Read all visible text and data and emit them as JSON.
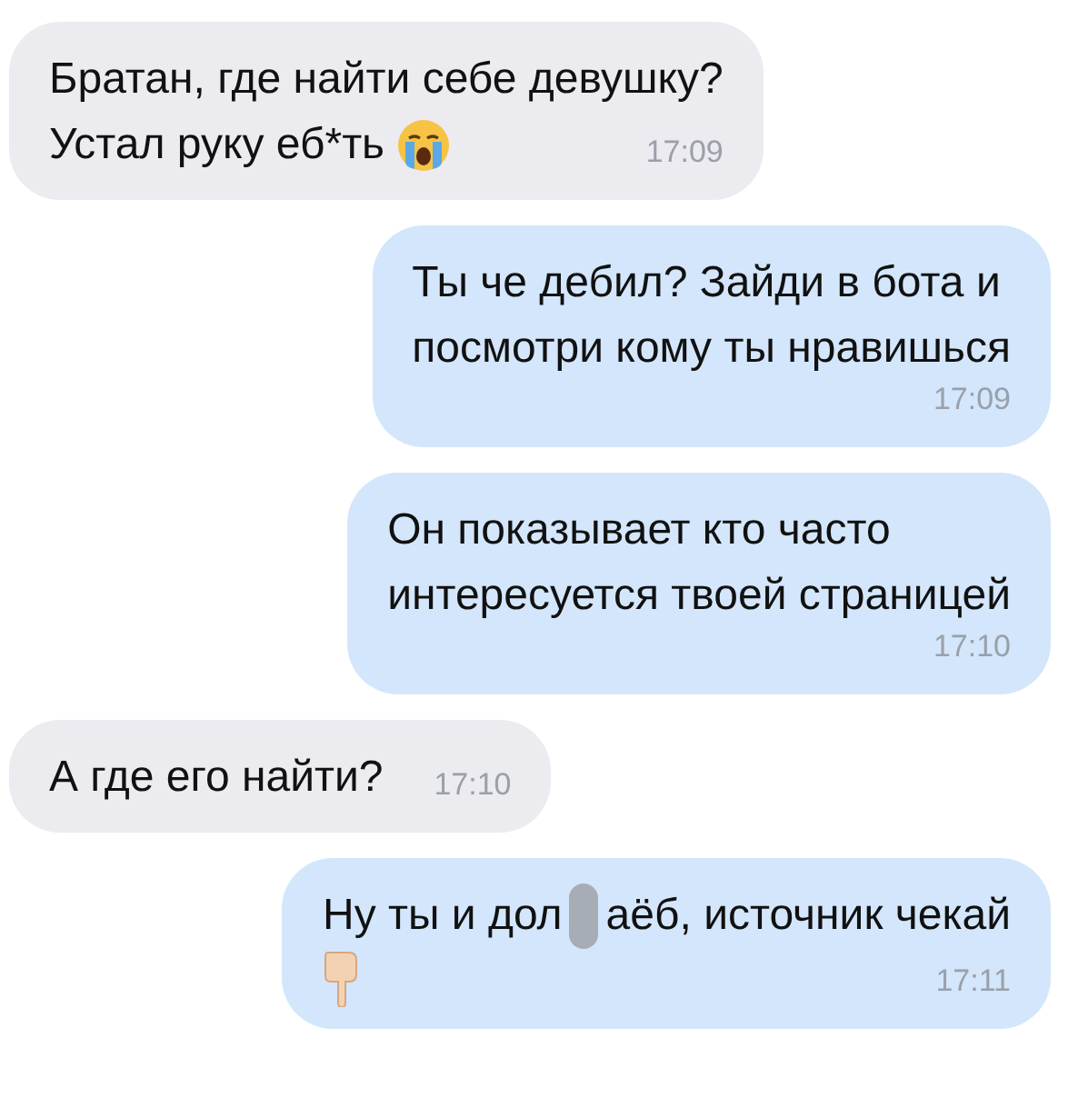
{
  "messages": [
    {
      "kind": "incoming",
      "lines": [
        [
          {
            "kind": "text",
            "text": "Братан, где найти себе девушку?"
          }
        ],
        [
          {
            "kind": "text",
            "text": "Устал руку еб*ть"
          },
          {
            "kind": "crying-emoji"
          },
          {
            "kind": "time",
            "text": "17:09"
          }
        ]
      ]
    },
    {
      "kind": "outgoing",
      "lines": [
        [
          {
            "kind": "text",
            "text": "Ты че дебил? Зайди в бота и"
          }
        ],
        [
          {
            "kind": "text",
            "text": "посмотри кому ты нравишься"
          }
        ],
        [
          {
            "kind": "time",
            "text": "17:09"
          }
        ]
      ]
    },
    {
      "kind": "outgoing",
      "lines": [
        [
          {
            "kind": "text",
            "text": "Он показывает кто часто"
          }
        ],
        [
          {
            "kind": "text",
            "text": "интересуется твоей страницей"
          }
        ],
        [
          {
            "kind": "time",
            "text": "17:10"
          }
        ]
      ]
    },
    {
      "kind": "incoming",
      "lines": [
        [
          {
            "kind": "text",
            "text": "А где его найти?"
          },
          {
            "kind": "time",
            "text": "17:10"
          }
        ]
      ]
    },
    {
      "kind": "outgoing",
      "lines": [
        [
          {
            "kind": "text",
            "text": "Ну ты и дол"
          },
          {
            "kind": "censor"
          },
          {
            "kind": "text",
            "text": "аёб, источник чекай"
          }
        ],
        [
          {
            "kind": "pointing-emoji"
          },
          {
            "kind": "time",
            "text": "17:11"
          }
        ]
      ]
    }
  ]
}
